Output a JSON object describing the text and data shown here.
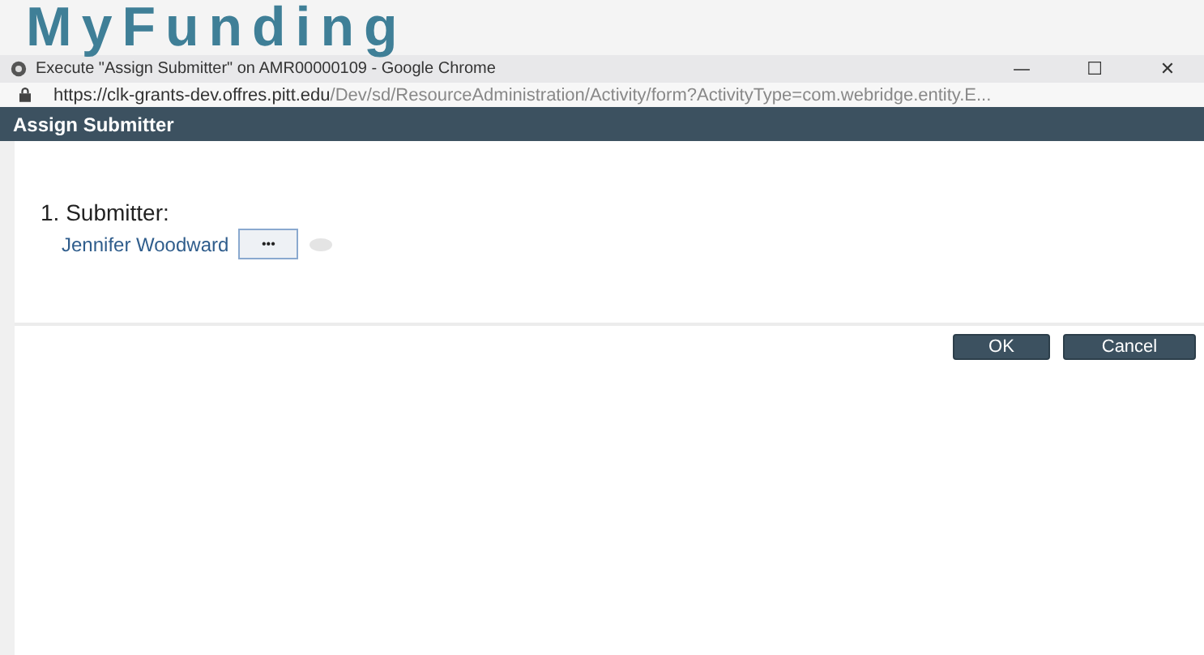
{
  "logo": {
    "text": "MyFunding"
  },
  "window": {
    "title": "Execute \"Assign Submitter\" on AMR00000109 - Google Chrome",
    "controls": [
      "—",
      "☐",
      "✕"
    ]
  },
  "address_bar": {
    "host": "https://clk-grants-dev.offres.pitt.edu",
    "path": "/Dev/sd/ResourceAdministration/Activity/form?ActivityType=com.webridge.entity.E..."
  },
  "dialog": {
    "title": "Assign Submitter",
    "fields": [
      {
        "number": "1.",
        "label": "Submitter:",
        "value": "Jennifer Woodward",
        "browse": "•••"
      }
    ],
    "buttons": [
      "OK",
      "Cancel"
    ]
  }
}
